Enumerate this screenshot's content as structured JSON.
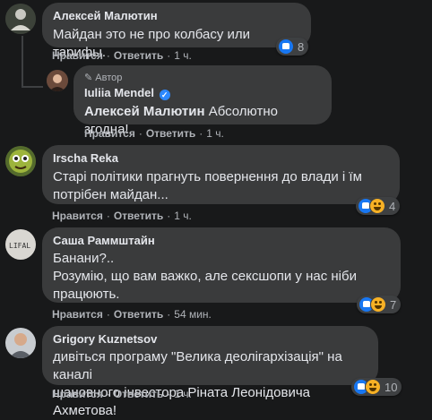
{
  "labels": {
    "like": "Нравится",
    "reply": "Ответить",
    "dot": "·",
    "author_badge": "Автор"
  },
  "comments": [
    {
      "author": "Алексей Малютин",
      "lines": [
        "Майдан это не про колбасу или тарифы."
      ],
      "time": "1 ч.",
      "reactions": "8"
    },
    {
      "author": "Iuliia Mendel",
      "mention": "Алексей Малютин",
      "text": "Абсолютно згодна!",
      "time": "1 ч."
    },
    {
      "author": "Irscha Reka",
      "lines": [
        "Старі політики прагнуть повернення до влади і їм",
        "потрібен майдан..."
      ],
      "time": "1 ч.",
      "reactions": "4"
    },
    {
      "author": "Саша Раммштайн",
      "lines": [
        "Банани?..",
        "Розумію, що вам важко, але сексшопи у нас ніби",
        "працюють."
      ],
      "time": "54 мин.",
      "reactions": "7"
    },
    {
      "author": "Grigory Kuznetsov",
      "lines": [
        "дивіться програму \"Велика деолігархізація\" на каналі",
        "шановного інвестора Ріната Леонідовича Ахметова!"
      ],
      "time": "1 ч.",
      "reactions": "10"
    }
  ],
  "avatar_text": "LIFAL",
  "colors": {
    "background": "#18191a",
    "bubble": "#3a3b3c",
    "accent": "#2d88ff",
    "muted": "#b0b3b8"
  }
}
